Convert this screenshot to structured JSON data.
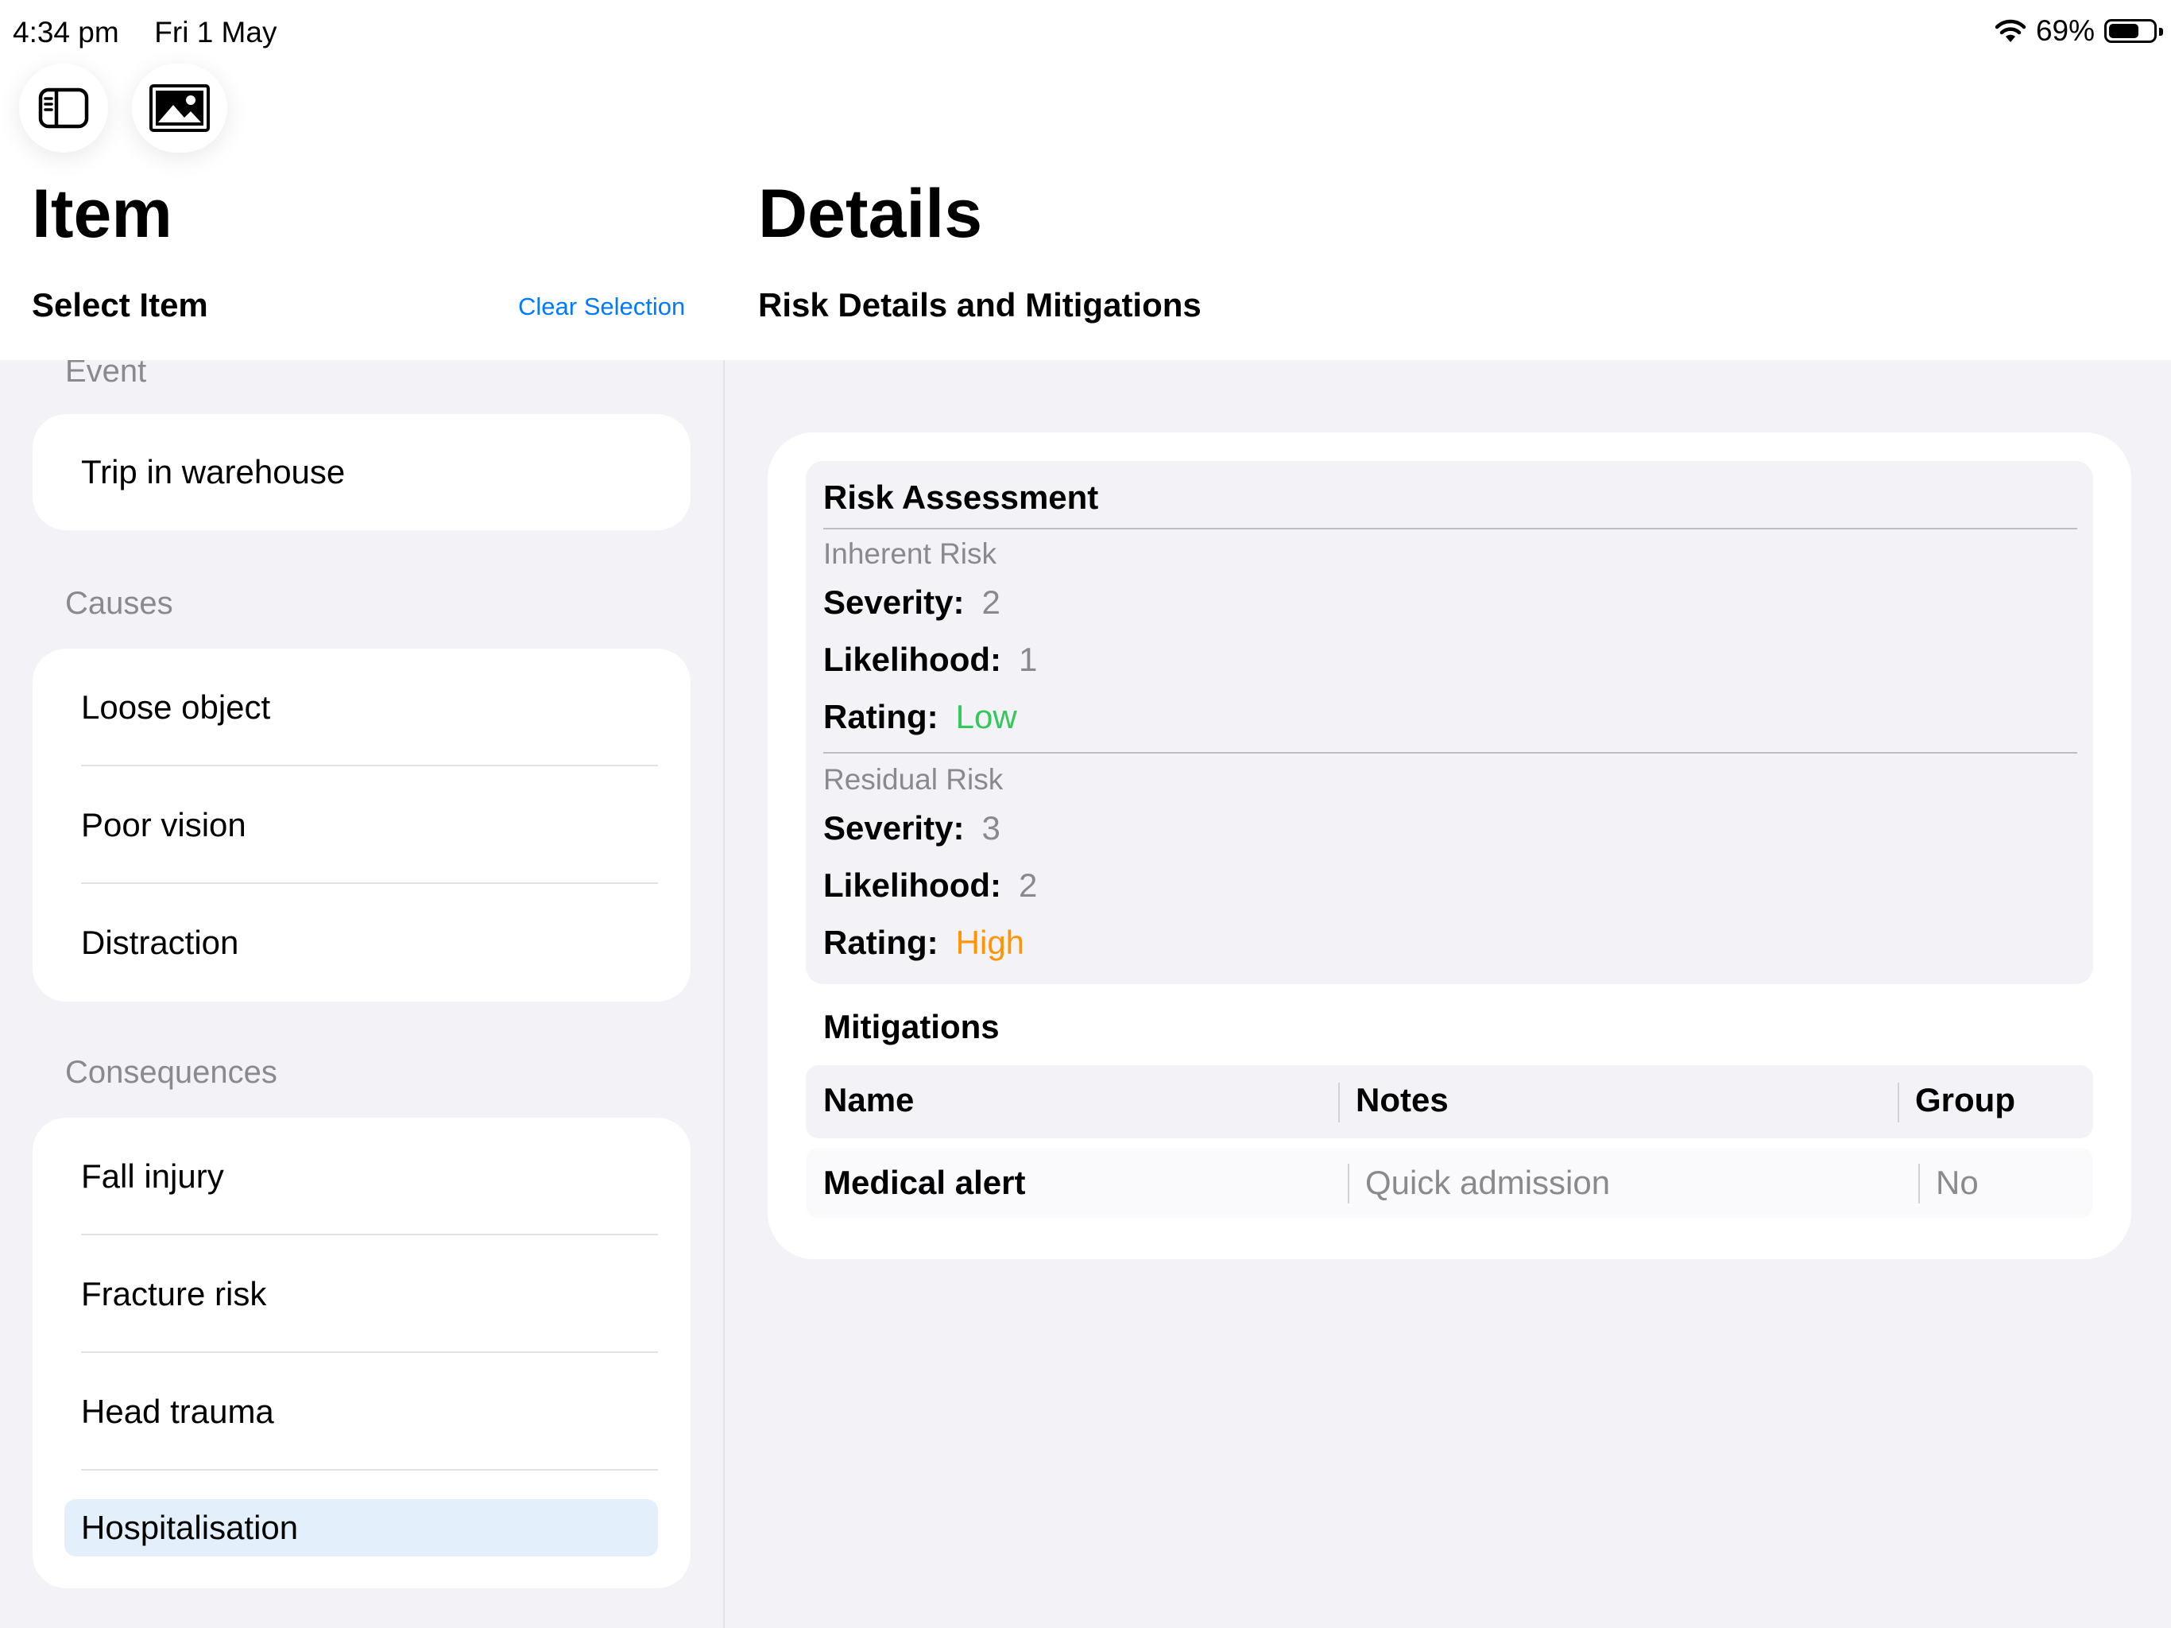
{
  "status_bar": {
    "time": "4:34 pm",
    "date": "Fri 1 May",
    "battery": "69%",
    "battery_level": 0.69
  },
  "toolbar": {
    "sidebar_toggle_icon": "sidebar-icon",
    "image_icon": "photo-icon"
  },
  "sidebar": {
    "title": "Item",
    "subtitle": "Select Item",
    "clear_label": "Clear Selection",
    "sections": {
      "event": {
        "label": "Event",
        "items": [
          "Trip in warehouse"
        ]
      },
      "causes": {
        "label": "Causes",
        "items": [
          "Loose object",
          "Poor vision",
          "Distraction"
        ]
      },
      "consequences": {
        "label": "Consequences",
        "items": [
          "Fall injury",
          "Fracture risk",
          "Head trauma",
          "Hospitalisation"
        ]
      }
    },
    "selected_item": "Hospitalisation"
  },
  "detail": {
    "title": "Details",
    "subtitle": "Risk Details and Mitigations",
    "risk_assessment": {
      "title": "Risk Assessment",
      "severity_label": "Severity:",
      "likelihood_label": "Likelihood:",
      "rating_label": "Rating:",
      "inherent": {
        "label": "Inherent Risk",
        "severity": "2",
        "likelihood": "1",
        "rating": "Low",
        "rating_color": "#34c759"
      },
      "residual": {
        "label": "Residual Risk",
        "severity": "3",
        "likelihood": "2",
        "rating": "High",
        "rating_color": "#ff9500"
      }
    },
    "mitigations": {
      "title": "Mitigations",
      "columns": [
        "Name",
        "Notes",
        "Group"
      ],
      "rows": [
        {
          "name": "Medical alert",
          "notes": "Quick admission",
          "group": "No"
        }
      ]
    }
  },
  "colors": {
    "accent": "#007aff",
    "background": "#f2f2f7",
    "selection": "#e3f0fc"
  }
}
